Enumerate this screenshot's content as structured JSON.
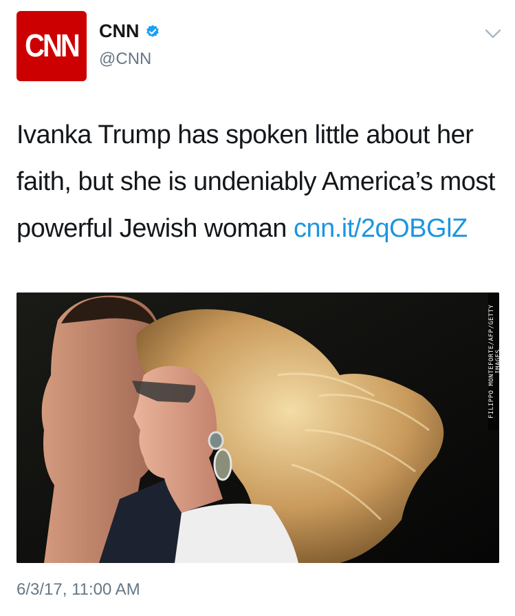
{
  "account": {
    "logo_text": "CNN",
    "display_name": "CNN",
    "handle": "@CNN",
    "verified": true
  },
  "tweet": {
    "text": "Ivanka Trump has spoken little about her faith, but she is undeniably America’s most powerful Jewish woman ",
    "link": "cnn.it/2qOBGlZ"
  },
  "media": {
    "photo_credit": "FILIPPO MONTEFORTE/AFP/GETTY IMAGES"
  },
  "timestamp": "6/3/17, 11:00 AM",
  "colors": {
    "brand_red": "#cc0000",
    "link_blue": "#1b95e0",
    "verified_blue": "#1da1f2",
    "muted": "#657786"
  },
  "icons": [
    "verified-badge-icon",
    "chevron-down-icon"
  ]
}
